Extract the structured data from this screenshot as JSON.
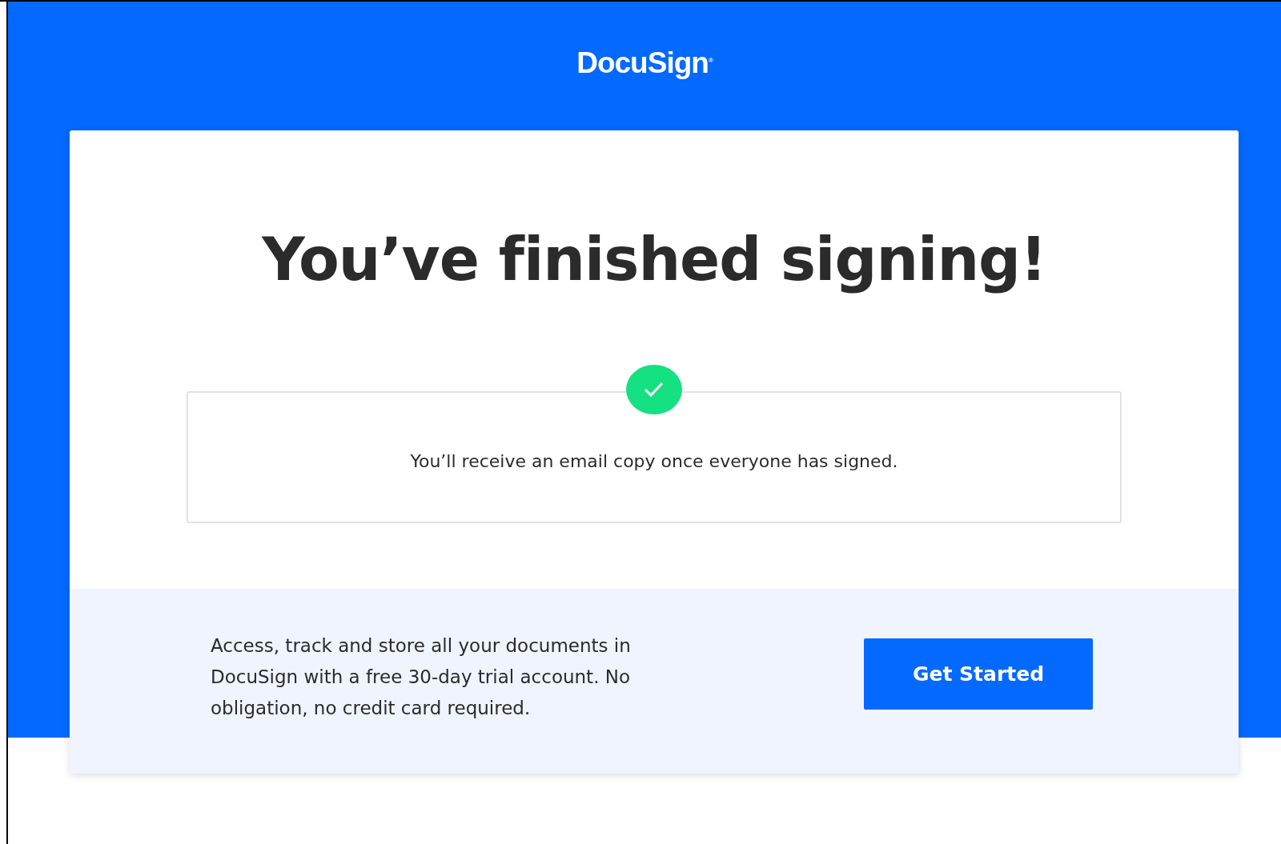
{
  "header": {
    "logo": "DocuSign$^{®}$"
  },
  "card": {
    "title": "You’ve finished signing!",
    "message": "You’ll receive an email copy once everyone has signed."
  },
  "promo": {
    "text": "Access, track and store all your documents in DocuSign with a free 30-day trial account. No obligation, no credit card required.",
    "button": "Get Started"
  }
}
